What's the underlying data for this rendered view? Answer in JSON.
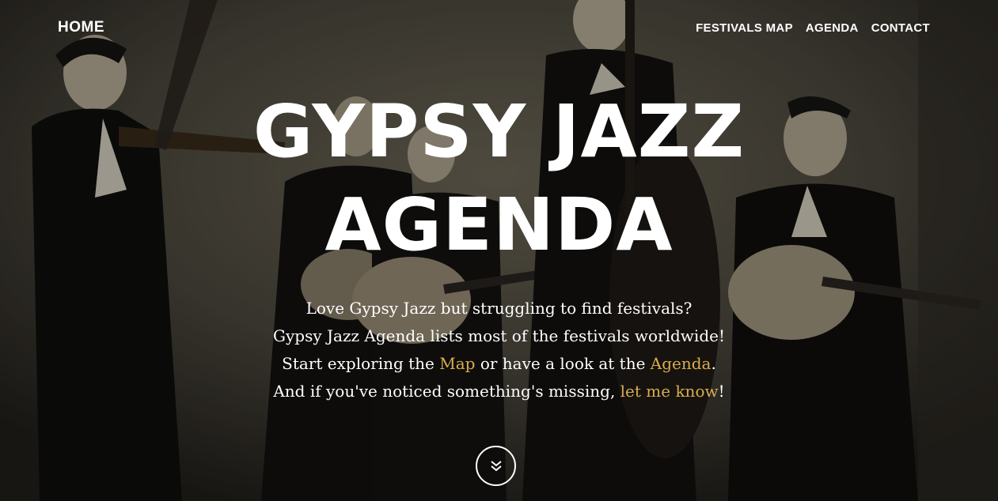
{
  "nav": {
    "home_label": "HOME",
    "links": [
      {
        "label": "FESTIVALS MAP"
      },
      {
        "label": "AGENDA"
      },
      {
        "label": "CONTACT"
      }
    ]
  },
  "hero": {
    "title_line1": "GYPSY JAZZ",
    "title_line2": "AGENDA",
    "line1": "Love Gypsy Jazz but struggling to find festivals?",
    "line2": "Gypsy Jazz Agenda lists most of the festivals worldwide!",
    "line3_prefix": "Start exploring the ",
    "line3_link1": "Map",
    "line3_middle": " or have a look at the ",
    "line3_link2": "Agenda",
    "line3_suffix": ".",
    "line4_prefix": "And if you've noticed something's missing, ",
    "line4_link": "let me know",
    "line4_suffix": "!"
  },
  "colors": {
    "link_accent": "#d9ad4f",
    "text": "#ffffff"
  },
  "icons": {
    "scroll_down": "double-chevron-down-icon"
  }
}
